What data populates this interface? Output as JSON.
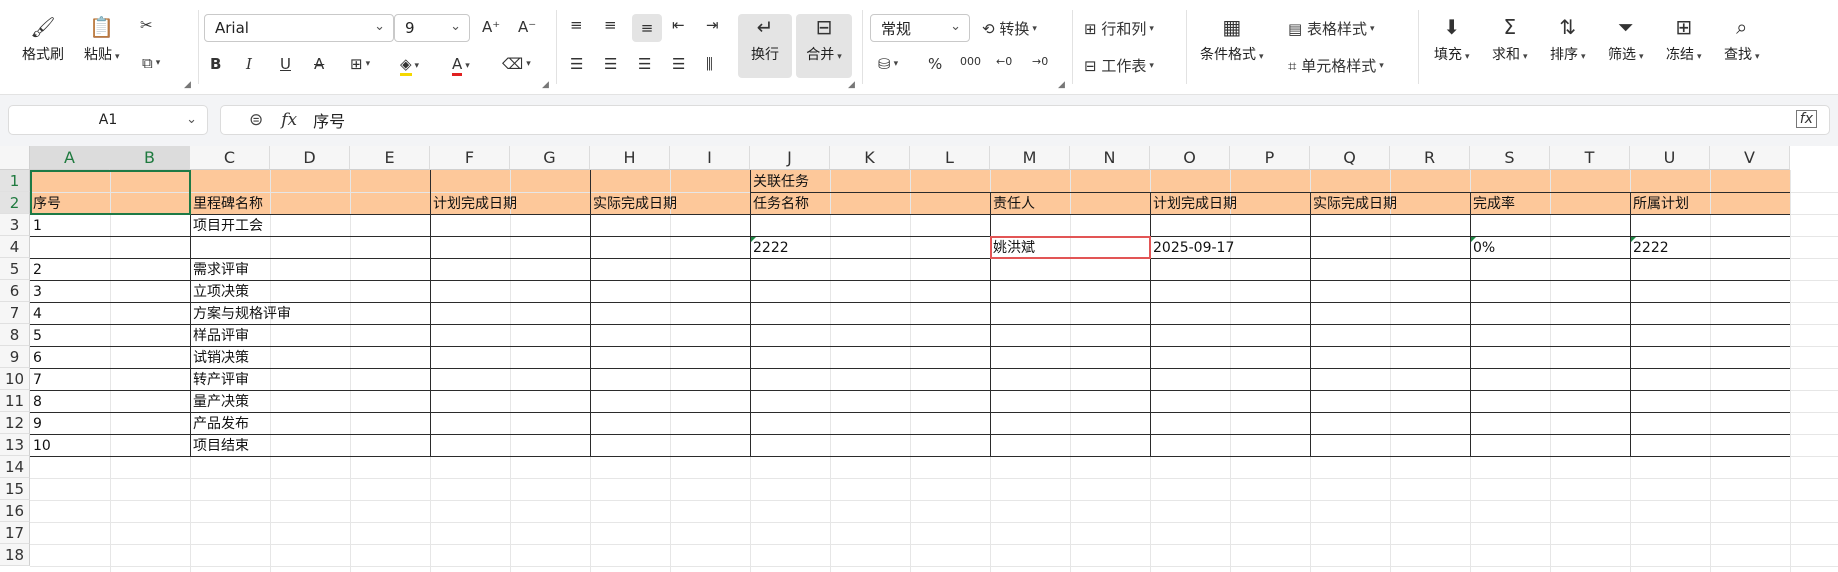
{
  "ribbon": {
    "format_painter": "格式刷",
    "paste": "粘贴",
    "font_name": "Arial",
    "font_size": "9",
    "wrap": "换行",
    "merge": "合并",
    "number_format": "常规",
    "convert": "转换",
    "rows_cols": "行和列",
    "worksheet": "工作表",
    "cond_format": "条件格式",
    "table_style": "表格样式",
    "cell_style": "单元格样式",
    "fill": "填充",
    "sum": "求和",
    "sort": "排序",
    "filter": "筛选",
    "freeze": "冻结",
    "find": "查找"
  },
  "formula_bar": {
    "name_box": "A1",
    "fx": "fx",
    "content": "序号"
  },
  "columns": [
    "A",
    "B",
    "C",
    "D",
    "E",
    "F",
    "G",
    "H",
    "I",
    "J",
    "K",
    "L",
    "M",
    "N",
    "O",
    "P",
    "Q",
    "R",
    "S",
    "T",
    "U",
    "V"
  ],
  "rows": [
    "1",
    "2",
    "3",
    "4",
    "5",
    "6",
    "7",
    "8",
    "9",
    "10",
    "11",
    "12",
    "13",
    "14",
    "15",
    "16",
    "17",
    "18"
  ],
  "sheet": {
    "group_header": "关联任务",
    "headers": {
      "seq": "序号",
      "milestone": "里程碑名称",
      "plan_date": "计划完成日期",
      "actual_date": "实际完成日期",
      "task_name": "任务名称",
      "owner": "责任人",
      "task_plan_date": "计划完成日期",
      "task_actual_date": "实际完成日期",
      "completion": "完成率",
      "plan": "所属计划"
    },
    "milestones": [
      {
        "seq": "1",
        "name": "项目开工会"
      },
      {
        "seq": "",
        "name": ""
      },
      {
        "seq": "2",
        "name": "需求评审"
      },
      {
        "seq": "3",
        "name": "立项决策"
      },
      {
        "seq": "4",
        "name": "方案与规格评审"
      },
      {
        "seq": "5",
        "name": "样品评审"
      },
      {
        "seq": "6",
        "name": "试销决策"
      },
      {
        "seq": "7",
        "name": "转产评审"
      },
      {
        "seq": "8",
        "name": "量产决策"
      },
      {
        "seq": "9",
        "name": "产品发布"
      },
      {
        "seq": "10",
        "name": "项目结束"
      }
    ],
    "task_row": {
      "task_name": "2222",
      "owner": "姚洪斌",
      "plan_date": "2025-09-17",
      "completion": "0%",
      "plan": "2222"
    }
  },
  "colors": {
    "header_fill": "#fdc89a",
    "selection": "#1d7a46",
    "active_cell": "#e25555"
  }
}
